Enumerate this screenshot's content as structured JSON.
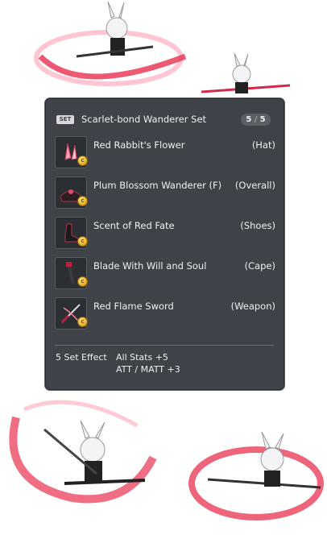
{
  "set": {
    "tag": "SET",
    "title": "Scarlet-bond Wanderer Set",
    "count_current": "5",
    "count_sep": "/",
    "count_total": "5"
  },
  "items": [
    {
      "name": "Red Rabbit's Flower",
      "type": "(Hat)",
      "icon": "rabbit-flower-icon"
    },
    {
      "name": "Plum Blossom Wanderer (F)",
      "type": "(Overall)",
      "icon": "overall-icon"
    },
    {
      "name": "Scent of Red Fate",
      "type": "(Shoes)",
      "icon": "shoes-icon"
    },
    {
      "name": "Blade With Will and Soul",
      "type": "(Cape)",
      "icon": "cape-blade-icon"
    },
    {
      "name": "Red Flame Sword",
      "type": "(Weapon)",
      "icon": "sword-icon"
    }
  ],
  "effect": {
    "label": "5 Set Effect",
    "line1": "All Stats  +5",
    "line2": "ATT / MATT  +3"
  },
  "colors": {
    "panel": "#3f4349",
    "accent_red": "#e84a6a",
    "text": "#eef0f2"
  }
}
